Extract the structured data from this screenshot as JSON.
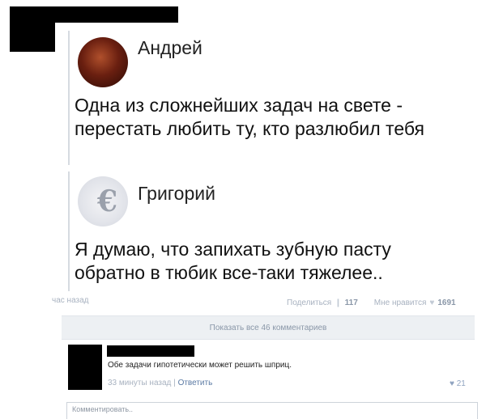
{
  "post": {
    "quote_1": {
      "author": "Андрей",
      "text": "Одна из сложнейших задач на свете - перестать любить ту, кто разлюбил тебя"
    },
    "quote_2": {
      "author": "Григорий",
      "text": "Я думаю, что запихать зубную пасту обратно в тюбик все-таки тяжелее.."
    },
    "time": "час назад",
    "share_label": "Поделиться",
    "share_count": "117",
    "like_label": "Мне нравится",
    "like_count": "1691"
  },
  "comments": {
    "show_all_label": "Показать все 46 комментариев",
    "items": [
      {
        "text": "Обе задачи гипотетически может решить шприц.",
        "time": "33 минуты назад",
        "reply_label": "Ответить",
        "likes": "21"
      }
    ],
    "input_placeholder": "Комментировать.."
  },
  "icons": {
    "share": "megaphone-icon",
    "like": "heart-icon"
  },
  "colors": {
    "meta_text": "#a8b2c0",
    "link": "#5b7aa4",
    "panel_bg": "#edf0f3"
  }
}
